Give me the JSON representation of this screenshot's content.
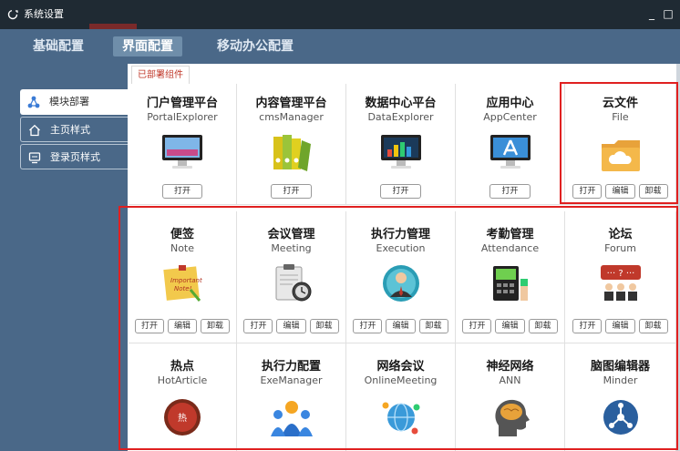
{
  "window": {
    "title": "系统设置",
    "minimize": "_",
    "maximize": "□"
  },
  "top_tabs": [
    {
      "label": "基础配置",
      "active": false
    },
    {
      "label": "界面配置",
      "active": true
    },
    {
      "label": "移动办公配置",
      "active": false
    }
  ],
  "sidebar": {
    "items": [
      {
        "label": "模块部署",
        "icon": "network-nodes-icon",
        "active": true
      },
      {
        "label": "主页样式",
        "icon": "home-icon",
        "active": false
      },
      {
        "label": "登录页样式",
        "icon": "monitor-icon",
        "active": false
      }
    ]
  },
  "subtab": {
    "label": "已部署组件"
  },
  "buttons": {
    "open": "打开",
    "edit": "编辑",
    "uninstall": "卸载"
  },
  "modules": [
    {
      "name": "门户管理平台",
      "en": "PortalExplorer",
      "icon": "monitor-icon",
      "actions": [
        "open"
      ]
    },
    {
      "name": "内容管理平台",
      "en": "cmsManager",
      "icon": "binders-icon",
      "actions": [
        "open"
      ]
    },
    {
      "name": "数据中心平台",
      "en": "DataExplorer",
      "icon": "chart-monitor-icon",
      "actions": [
        "open"
      ]
    },
    {
      "name": "应用中心",
      "en": "AppCenter",
      "icon": "app-store-icon",
      "actions": [
        "open"
      ]
    },
    {
      "name": "云文件",
      "en": "File",
      "icon": "cloud-folder-icon",
      "actions": [
        "open",
        "edit",
        "uninstall"
      ]
    },
    {
      "name": "便签",
      "en": "Note",
      "icon": "sticky-note-icon",
      "actions": [
        "open",
        "edit",
        "uninstall"
      ]
    },
    {
      "name": "会议管理",
      "en": "Meeting",
      "icon": "clipboard-clock-icon",
      "actions": [
        "open",
        "edit",
        "uninstall"
      ]
    },
    {
      "name": "执行力管理",
      "en": "Execution",
      "icon": "businessman-icon",
      "actions": [
        "open",
        "edit",
        "uninstall"
      ]
    },
    {
      "name": "考勤管理",
      "en": "Attendance",
      "icon": "fingerprint-terminal-icon",
      "actions": [
        "open",
        "edit",
        "uninstall"
      ]
    },
    {
      "name": "论坛",
      "en": "Forum",
      "icon": "forum-people-icon",
      "actions": [
        "open",
        "edit",
        "uninstall"
      ]
    },
    {
      "name": "热点",
      "en": "HotArticle",
      "icon": "hotspot-badge-icon",
      "actions": []
    },
    {
      "name": "执行力配置",
      "en": "ExeManager",
      "icon": "team-icon",
      "actions": []
    },
    {
      "name": "网络会议",
      "en": "OnlineMeeting",
      "icon": "globe-network-icon",
      "actions": []
    },
    {
      "name": "神经网络",
      "en": "ANN",
      "icon": "brain-head-icon",
      "actions": []
    },
    {
      "name": "脑图编辑器",
      "en": "Minder",
      "icon": "mind-map-icon",
      "actions": []
    }
  ],
  "colors": {
    "highlight": "#e02020",
    "nav_bg": "#4a6888",
    "titlebar_bg": "#1f2a33",
    "subtab_text": "#c0392b"
  }
}
